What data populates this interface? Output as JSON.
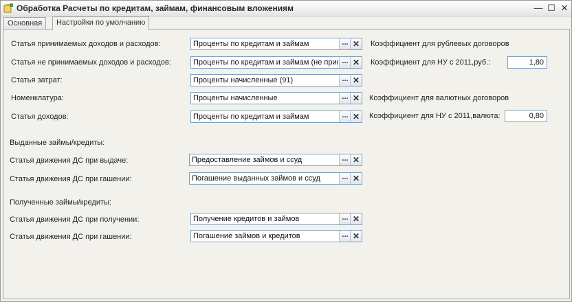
{
  "window": {
    "title": "Обработка  Расчеты по кредитам, займам, финансовым вложениям",
    "controls": {
      "minimize": "—",
      "maximize": "☐",
      "close": "✕"
    }
  },
  "tabs": [
    {
      "label": "Основная",
      "active": false
    },
    {
      "label": "Настройки по умолчанию",
      "active": true
    }
  ],
  "fields": {
    "income_expense_accepted": {
      "label": "Статья принимаемых доходов и расходов:",
      "value": "Проценты по кредитам и займам"
    },
    "income_expense_not_accepted": {
      "label": "Статья не принимаемых доходов и расходов:",
      "value": "Проценты по кредитам и займам (не прин"
    },
    "cost_item": {
      "label": "Статья затрат:",
      "value": "Проценты начисленные (91)"
    },
    "nomenclature": {
      "label": "Номенклатура:",
      "value": "Проценты начисленные"
    },
    "income_item": {
      "label": "Статья доходов:",
      "value": "Проценты по кредитам и займам"
    }
  },
  "issued_section": {
    "heading": "Выданные займы/кредиты:",
    "on_issue": {
      "label": "Статья движения ДС при выдаче:",
      "value": "Предоставление займов и ссуд"
    },
    "on_repay": {
      "label": "Статья движения ДС при гашении:",
      "value": "Погашение выданных займов и ссуд"
    }
  },
  "received_section": {
    "heading": "Полученные займы/кредиты:",
    "on_receive": {
      "label": "Статья движения ДС при получении:",
      "value": "Получение кредитов и займов"
    },
    "on_repay": {
      "label": "Статья движения ДС при гашении:",
      "value": "Погашение займов и кредитов"
    }
  },
  "coefficients": {
    "ruble_heading": "Коэффициент для рублевых договоров",
    "ruble_label": "Коэффициент для НУ с 2011,руб.:",
    "ruble_value": "1,80",
    "currency_heading": "Коэффициент для валютных договоров",
    "currency_label": "Коэффициент для НУ с 2011,валюта:",
    "currency_value": "0,80"
  },
  "buttons": {
    "select": "...",
    "clear": "✕"
  }
}
